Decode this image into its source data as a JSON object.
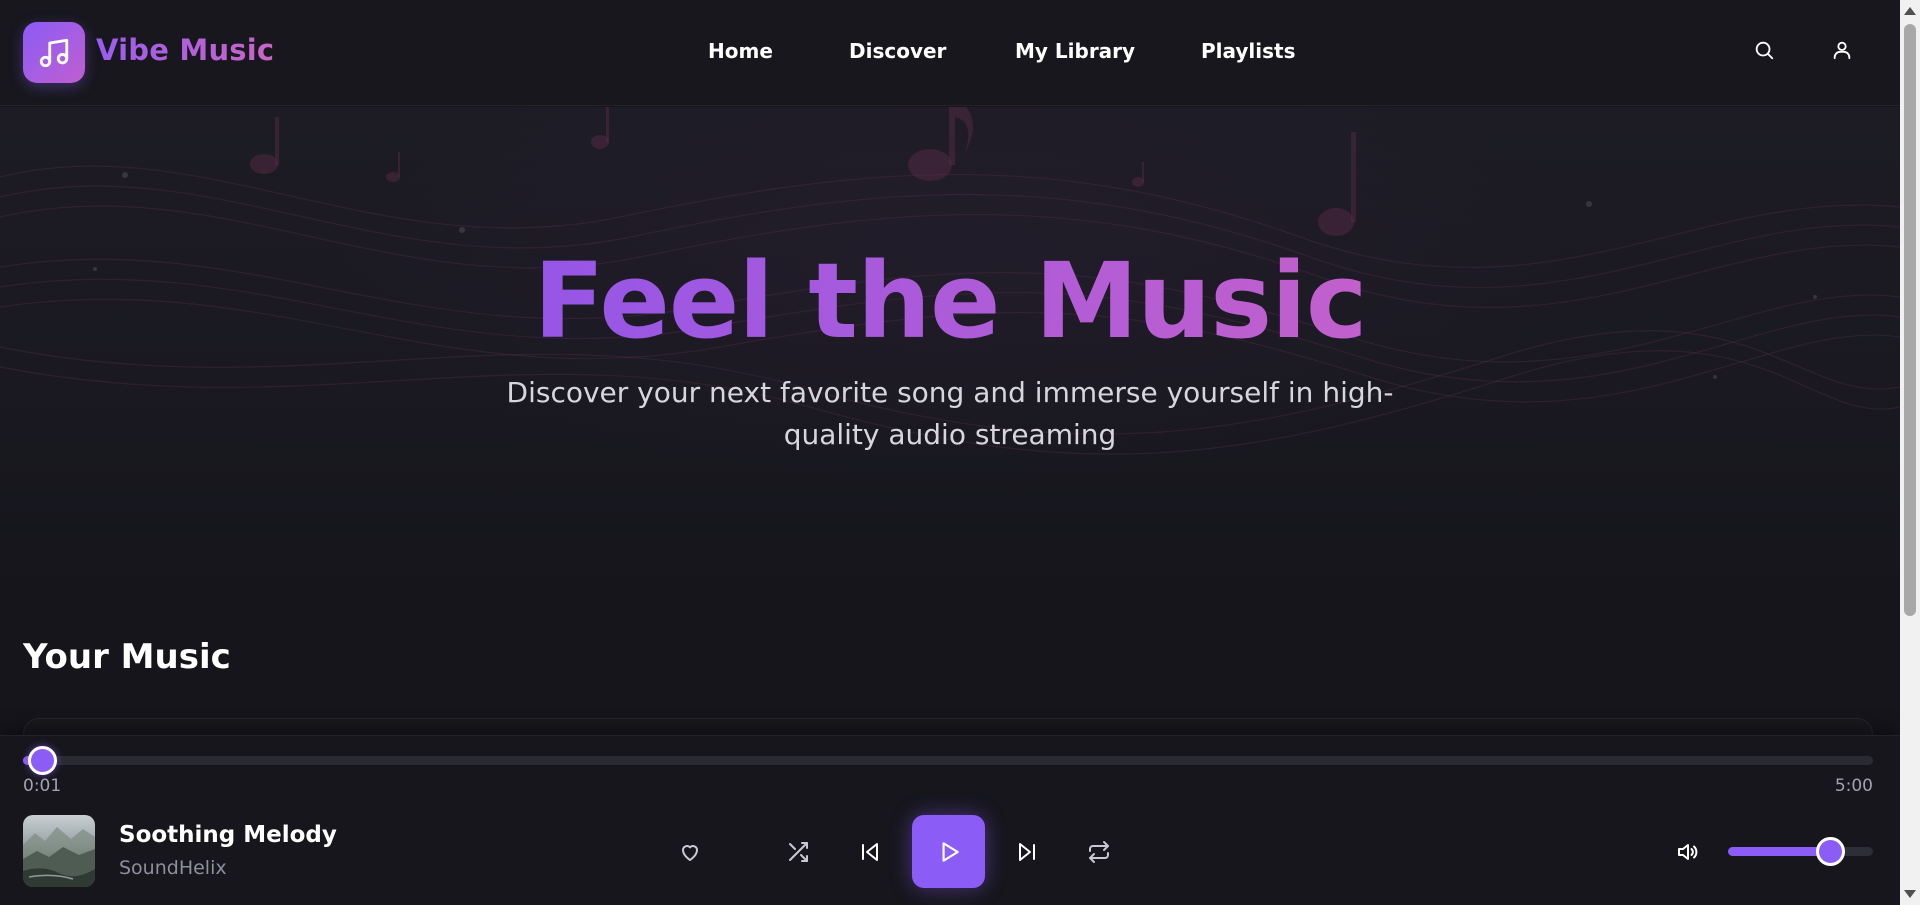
{
  "app": {
    "name": "Vibe Music",
    "logo_icon": "music-note-icon",
    "accent_color": "#8b5cf6",
    "accent_color_2": "#c866c6"
  },
  "nav": {
    "items": [
      {
        "label": "Home"
      },
      {
        "label": "Discover"
      },
      {
        "label": "My Library"
      },
      {
        "label": "Playlists"
      }
    ],
    "search_icon": "search-icon",
    "account_icon": "user-icon"
  },
  "hero": {
    "title": "Feel the Music",
    "subtitle": "Discover your next favorite song and immerse yourself in high-quality audio streaming"
  },
  "section": {
    "title": "Your Music"
  },
  "player": {
    "track_title": "Soothing Melody",
    "artist": "SoundHelix",
    "current_time": "0:01",
    "duration": "5:00",
    "progress_fraction": 0.003,
    "volume_fraction": 0.7,
    "is_playing": false,
    "controls": [
      "heart-icon",
      "shuffle-icon",
      "skip-back-icon",
      "play-icon",
      "skip-forward-icon",
      "repeat-icon",
      "volume-icon"
    ]
  }
}
